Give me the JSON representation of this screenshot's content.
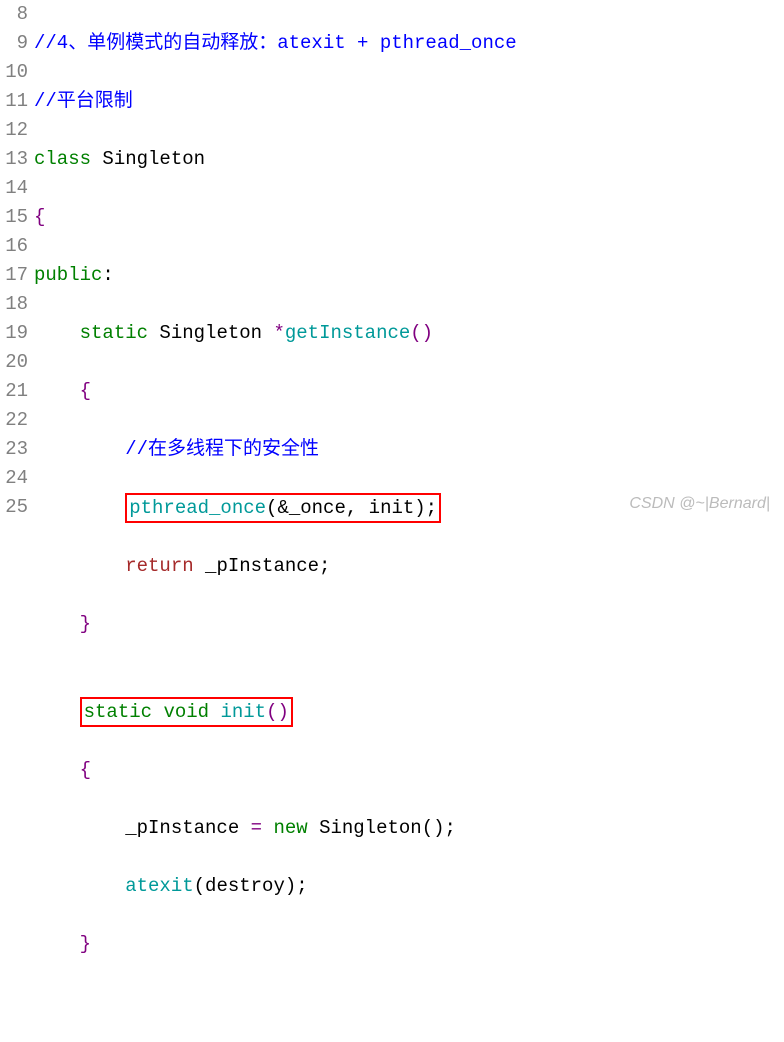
{
  "lines": {
    "n8": "8",
    "n9": "9",
    "n10": "10",
    "n11": "11",
    "n12": "12",
    "n13": "13",
    "n14": "14",
    "n15": "15",
    "n16": "16",
    "n17": "17",
    "n18": "18",
    "n19": "19",
    "n20": "20",
    "n21": "21",
    "n22": "22",
    "n23": "23",
    "n24": "24",
    "n25": "25"
  },
  "c": {
    "l8": "//4、单例模式的自动释放：atexit + pthread_once",
    "l9": "//平台限制",
    "l10_kw": "class",
    "l10_name": " Singleton",
    "l11": "{",
    "l12_kw": "public",
    "l12_colon": ":",
    "l13_pad": "    ",
    "l13_static": "static",
    "l13_sp": " Singleton ",
    "l13_star": "*",
    "l13_get": "getInstance",
    "l13_paren": "()",
    "l14_pad": "    ",
    "l14_brace": "{",
    "l15_pad": "        ",
    "l15_cmt": "//在多线程下的安全性",
    "l16_pad": "        ",
    "l16_call": "pthread_once",
    "l16_args": "(&_once, init);",
    "l17_pad": "        ",
    "l17_ret": "return",
    "l17_rest": " _pInstance;",
    "l18_pad": "    ",
    "l18_brace": "}",
    "l19": "",
    "l20_pad": "    ",
    "l20_static": "static",
    "l20_sp": " ",
    "l20_void": "void",
    "l20_sp2": " ",
    "l20_init": "init",
    "l20_paren": "()",
    "l21_pad": "    ",
    "l21_brace": "{",
    "l22_pad": "        ",
    "l22_lhs": "_pInstance ",
    "l22_eq": "=",
    "l22_sp": " ",
    "l22_new": "new",
    "l22_rest": " Singleton();",
    "l23_pad": "        ",
    "l23_call": "atexit",
    "l23_args": "(destroy);",
    "l24_pad": "    ",
    "l24_brace": "}",
    "l25": ""
  },
  "watermark": "CSDN @~|Bernard|"
}
